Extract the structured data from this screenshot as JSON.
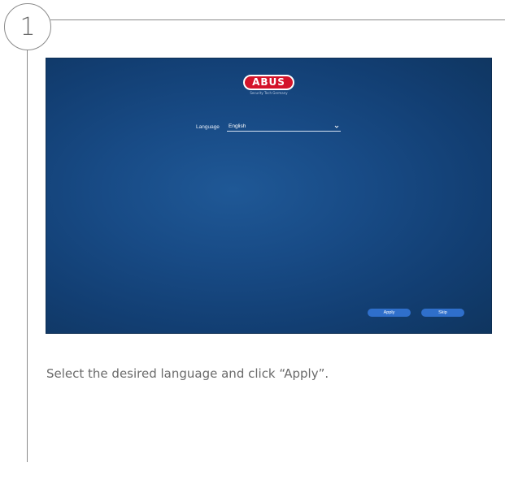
{
  "step": {
    "number": "1"
  },
  "screen": {
    "logo": {
      "text": "ABUS",
      "tagline": "Security Tech Germany"
    },
    "language": {
      "label": "Language",
      "selected": "English"
    },
    "buttons": {
      "apply": "Apply",
      "skip": "Skip"
    },
    "icons": {
      "dropdown": "chevron-down-icon"
    },
    "colors": {
      "background": "#184b86",
      "button": "#2f6fcb",
      "logo_red": "#d4142a"
    }
  },
  "instruction": {
    "text": "Select the desired language and click “Apply”."
  }
}
